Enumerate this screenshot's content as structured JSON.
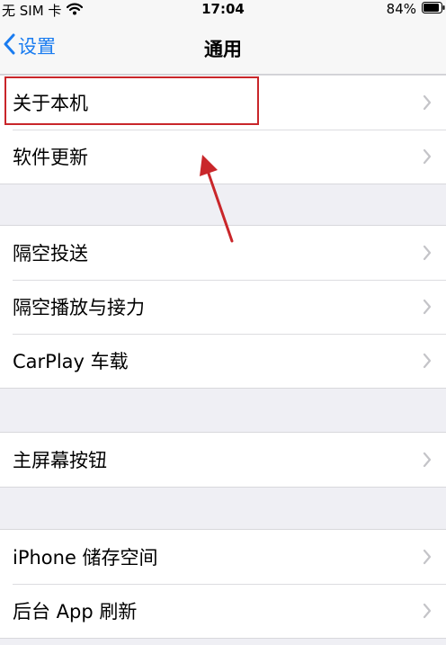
{
  "status_bar": {
    "carrier": "无 SIM 卡",
    "time": "17:04",
    "battery": "84%"
  },
  "nav": {
    "back_label": "设置",
    "title": "通用"
  },
  "groups": [
    {
      "items": [
        "关于本机",
        "软件更新"
      ]
    },
    {
      "items": [
        "隔空投送",
        "隔空播放与接力",
        "CarPlay 车载"
      ]
    },
    {
      "items": [
        "主屏幕按钮"
      ]
    },
    {
      "items": [
        "iPhone 储存空间",
        "后台 App 刷新"
      ]
    }
  ],
  "colors": {
    "accent": "#1a7cf0",
    "annotation": "#c9262a",
    "background": "#efeff4"
  }
}
